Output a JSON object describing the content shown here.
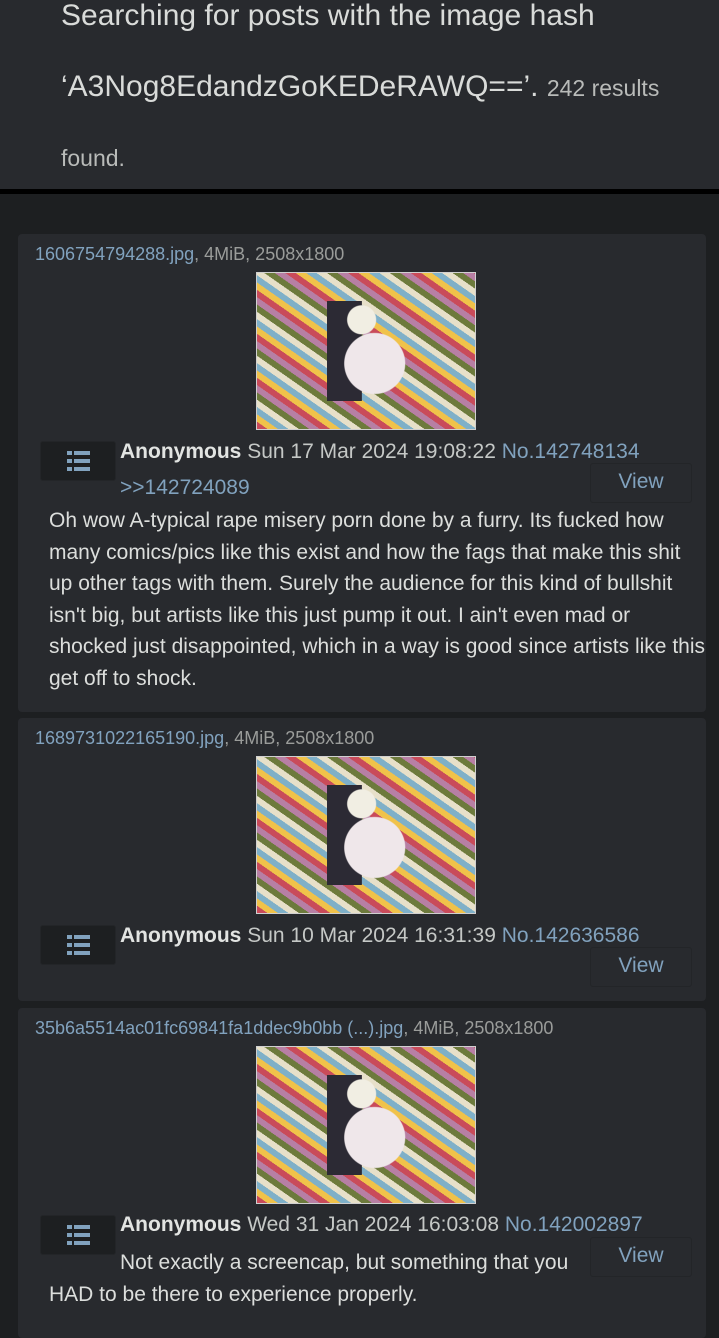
{
  "search": {
    "line1": "Searching for posts with the image hash",
    "hash": "‘A3Nog8EdandzGoKEDeRAWQ==’.",
    "count": "242 results",
    "found": "found."
  },
  "posts": [
    {
      "filename": "1606754794288.jpg",
      "fileinfo": ", 4MiB, 2508x1800",
      "name": "Anonymous",
      "date": "Sun 17 Mar 2024 19:08:22",
      "postno": "No.142748134",
      "quote": ">>142724089",
      "view": "View",
      "comment": "Oh wow A-typical rape misery porn done by a furry. Its fucked how many comics/pics like this exist and how the fags that make this shit up other tags with them. Surely the audience for this kind of bullshit isn't big, but artists like this just pump it out. I ain't even mad or shocked just disappointed, which in a way is good since artists like this get off to shock."
    },
    {
      "filename": "1689731022165190.jpg",
      "fileinfo": ", 4MiB, 2508x1800",
      "name": "Anonymous",
      "date": "Sun 10 Mar 2024 16:31:39",
      "postno": "No.142636586",
      "view": "View"
    },
    {
      "filename": "35b6a5514ac01fc69841fa1ddec9b0bb (...).jpg",
      "fileinfo": ", 4MiB, 2508x1800",
      "name": "Anonymous",
      "date": "Wed 31 Jan 2024 16:03:08",
      "postno": "No.142002897",
      "view": "View",
      "comment": "Not exactly a screencap, but something that you HAD to be there to experience properly."
    }
  ]
}
